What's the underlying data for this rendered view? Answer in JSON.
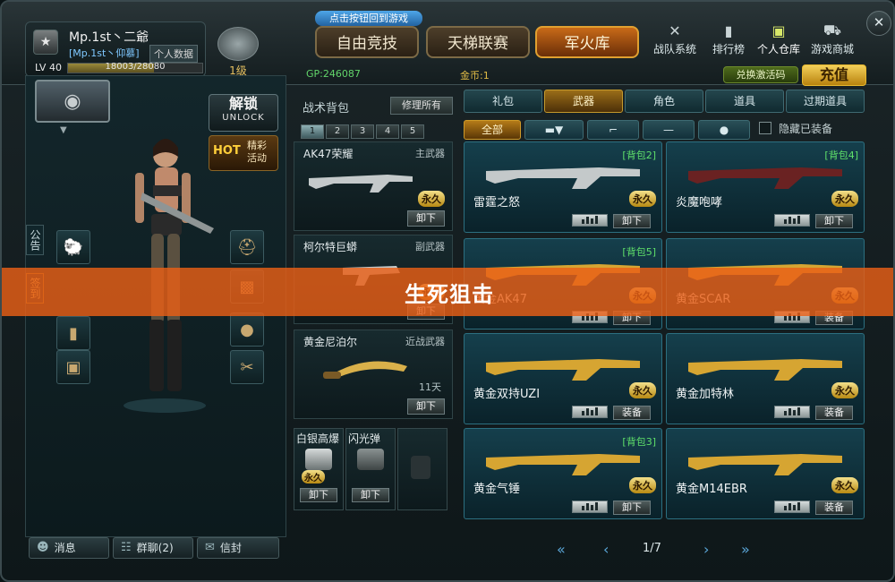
{
  "tip": "点击按钮回到游戏",
  "player": {
    "name": "Mp.1st丶二爺",
    "clan": "[Mp.1st丶仰慕]",
    "profile_btn": "个人数据",
    "level": "LV 40",
    "xp_text": "18003/28080",
    "xp_fraction": 0.64,
    "rank_label": "1级"
  },
  "modes": [
    "自由竞技",
    "天梯联赛",
    "军火库"
  ],
  "active_mode": 2,
  "nav": [
    {
      "label": "战队系统",
      "icon": "crossed-swords-icon",
      "glyph": "✕"
    },
    {
      "label": "排行榜",
      "icon": "bar-chart-icon",
      "glyph": "▮"
    },
    {
      "label": "个人仓库",
      "icon": "box-icon",
      "glyph": "▣"
    },
    {
      "label": "游戏商城",
      "icon": "cart-icon",
      "glyph": "⛟"
    }
  ],
  "currency": {
    "gp": "GP:246087",
    "gold": "金币:1"
  },
  "redeem_label": "兑换激活码",
  "recharge_label": "充值",
  "unlock": {
    "cn": "解锁",
    "en": "UNLOCK"
  },
  "hot": {
    "label": "HOT",
    "event": "精彩活动"
  },
  "sidetabs": [
    "公告",
    "签到"
  ],
  "bag": {
    "title": "战术背包",
    "repair": "修理所有",
    "tabs": [
      "1",
      "2",
      "3",
      "4",
      "5"
    ],
    "slots": [
      {
        "name": "AK47荣耀",
        "type": "主武器",
        "tag": "永久",
        "action": "卸下"
      },
      {
        "name": "柯尔特巨蟒",
        "type": "副武器",
        "tag": "永久",
        "action": "卸下"
      },
      {
        "name": "黄金尼泊尔",
        "type": "近战武器",
        "tag": "11天",
        "action": "卸下"
      }
    ],
    "small": [
      {
        "name": "白银高爆",
        "tag": "永久",
        "action": "卸下"
      },
      {
        "name": "闪光弹",
        "tag": "",
        "action": "卸下"
      }
    ]
  },
  "categories": [
    "礼包",
    "武器",
    "角色",
    "道具",
    "过期道具"
  ],
  "active_category": 1,
  "filters": {
    "all": "全部",
    "hide_label": "隐藏已装备"
  },
  "weapons": [
    {
      "name": "雷霆之怒",
      "bag": "[背包2]",
      "tag": "永久",
      "action": "卸下"
    },
    {
      "name": "炎魔咆哮",
      "bag": "[背包4]",
      "tag": "永久",
      "action": "卸下"
    },
    {
      "name": "黄金AK47",
      "bag": "[背包5]",
      "tag": "永久",
      "action": "卸下"
    },
    {
      "name": "黄金SCAR",
      "bag": "",
      "tag": "永久",
      "action": "装备"
    },
    {
      "name": "黄金双持UZI",
      "bag": "",
      "tag": "永久",
      "action": "装备"
    },
    {
      "name": "黄金加特林",
      "bag": "",
      "tag": "永久",
      "action": "装备"
    },
    {
      "name": "黄金气锤",
      "bag": "[背包3]",
      "tag": "永久",
      "action": "卸下"
    },
    {
      "name": "黄金M14EBR",
      "bag": "",
      "tag": "永久",
      "action": "装备"
    }
  ],
  "pagination": {
    "text": "1/7"
  },
  "bottom": {
    "messages": "消息",
    "group_chat": "群聊(2)",
    "mail": "信封"
  },
  "banner": "生死狙击",
  "colors": {
    "accent": "#e95f16",
    "gold": "#f3d05a",
    "panel": "#153f4c"
  }
}
